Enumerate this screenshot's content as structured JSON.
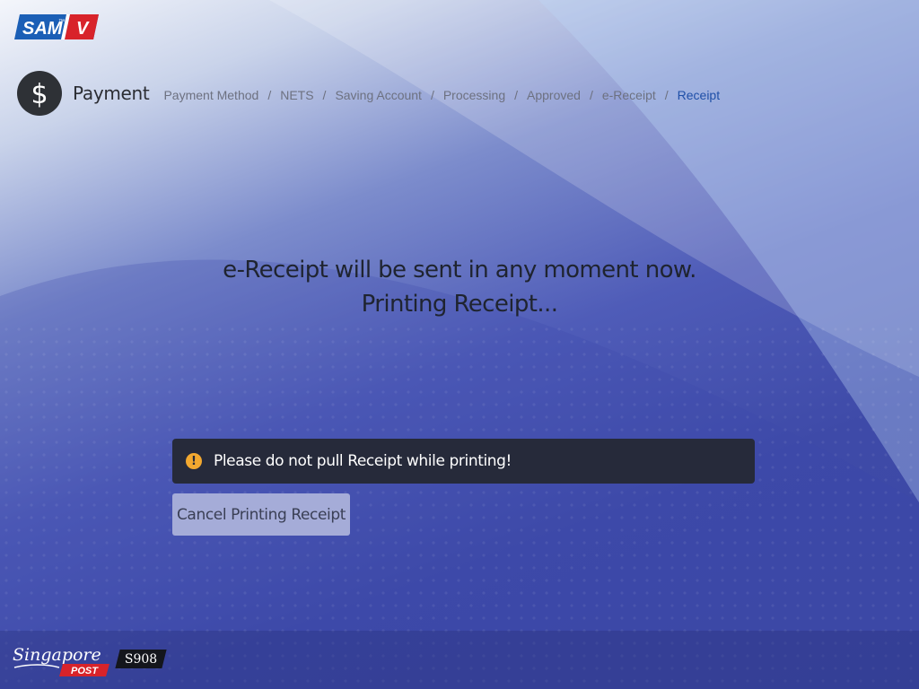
{
  "brand": {
    "logo_text": "SAM",
    "logo_sup": "™",
    "logo_v": "V",
    "logo_color": "#1b5fb6",
    "logo_accent": "#d8232a"
  },
  "header": {
    "icon": "dollar-icon",
    "title": "Payment",
    "breadcrumb": [
      {
        "label": "Payment Method"
      },
      {
        "label": "NETS"
      },
      {
        "label": "Saving Account"
      },
      {
        "label": "Processing"
      },
      {
        "label": "Approved"
      },
      {
        "label": "e-Receipt"
      },
      {
        "label": "Receipt"
      }
    ],
    "separator": "/",
    "active_color": "#1f4fa8"
  },
  "message": {
    "line1": "e-Receipt will be sent in any moment now.",
    "line2": "Printing Receipt..."
  },
  "warning": {
    "icon": "exclamation-icon",
    "icon_glyph": "!",
    "text": "Please do not pull Receipt while printing!",
    "icon_color": "#f2a830"
  },
  "actions": {
    "cancel_label": "Cancel Printing Receipt"
  },
  "footer": {
    "brand_script": "Singapore",
    "brand_post": "POST",
    "kiosk_id": "S908"
  }
}
